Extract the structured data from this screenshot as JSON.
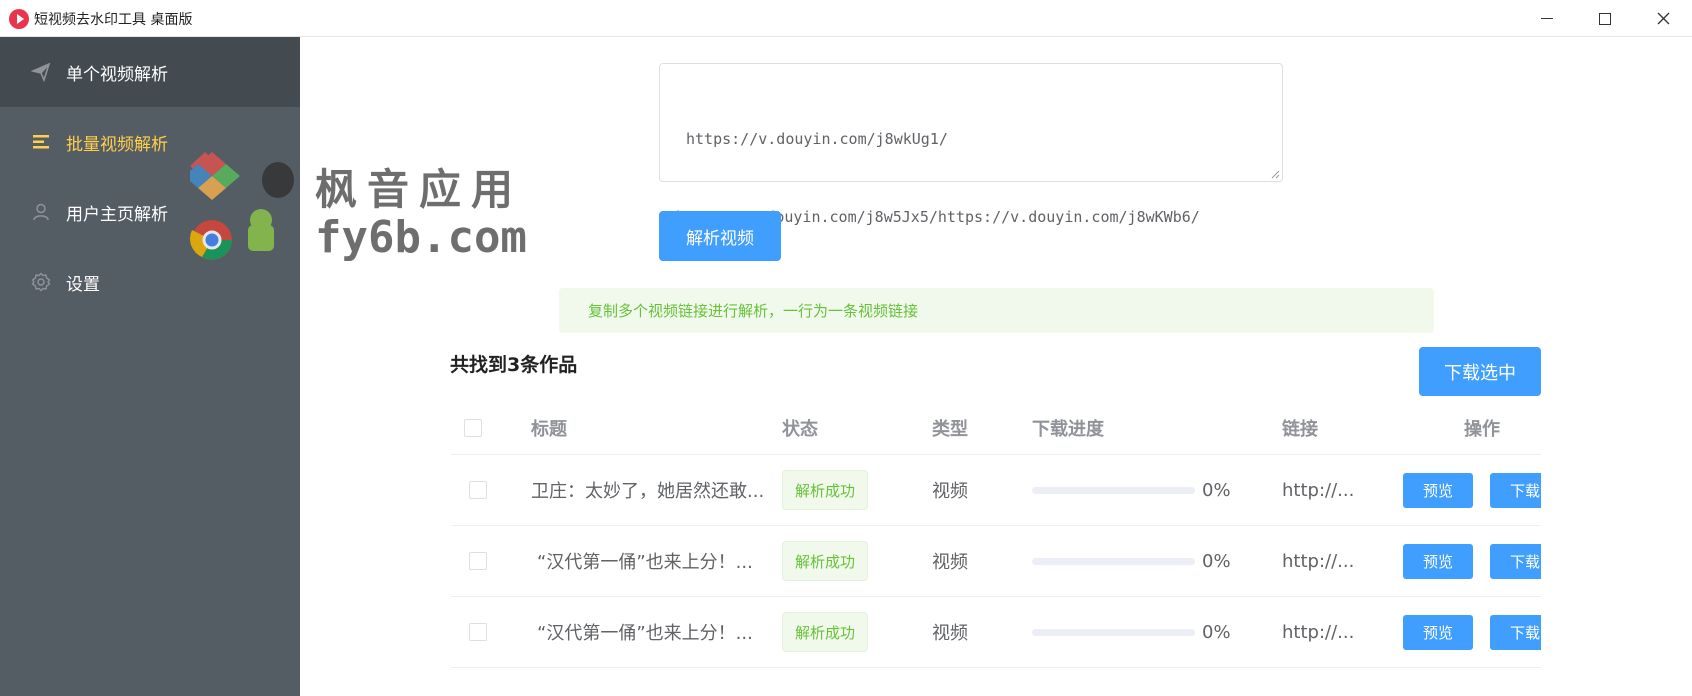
{
  "window": {
    "title": "短视频去水印工具 桌面版"
  },
  "sidebar": {
    "items": [
      {
        "label": "单个视频解析",
        "icon": "paper-plane-icon"
      },
      {
        "label": "批量视频解析",
        "icon": "list-icon"
      },
      {
        "label": "用户主页解析",
        "icon": "user-icon"
      },
      {
        "label": "设置",
        "icon": "gear-icon"
      }
    ]
  },
  "watermark": {
    "line1": "枫音应用",
    "line2": "fy6b.com"
  },
  "input": {
    "value_line1": "https://v.douyin.com/j8wkUg1/",
    "value_line2": "https://v.douyin.com/j8w5Jx5/https://v.douyin.com/j8wKWb6/"
  },
  "parse_button": "解析视频",
  "tip": "复制多个视频链接进行解析，一行为一条视频链接",
  "found_text": "共找到3条作品",
  "download_selected_button": "下载选中",
  "table": {
    "headers": {
      "title": "标题",
      "status": "状态",
      "type": "类型",
      "progress": "下载进度",
      "link": "链接",
      "actions": "操作"
    },
    "rows": [
      {
        "title": "卫庄：太妙了，她居然还敢...",
        "status": "解析成功",
        "type": "视频",
        "progress": 0,
        "progress_text": "0%",
        "link": "http://...",
        "preview": "预览",
        "download": "下载"
      },
      {
        "title": "“汉代第一俑”也来上分！...",
        "status": "解析成功",
        "type": "视频",
        "progress": 0,
        "progress_text": "0%",
        "link": "http://...",
        "preview": "预览",
        "download": "下载"
      },
      {
        "title": "“汉代第一俑”也来上分！...",
        "status": "解析成功",
        "type": "视频",
        "progress": 0,
        "progress_text": "0%",
        "link": "http://...",
        "preview": "预览",
        "download": "下载"
      }
    ]
  },
  "colors": {
    "sidebar_bg": "#545c64",
    "sidebar_active_bg": "#434a50",
    "sidebar_selected_text": "#ffd04b",
    "primary": "#409eff",
    "success": "#67c23a"
  }
}
